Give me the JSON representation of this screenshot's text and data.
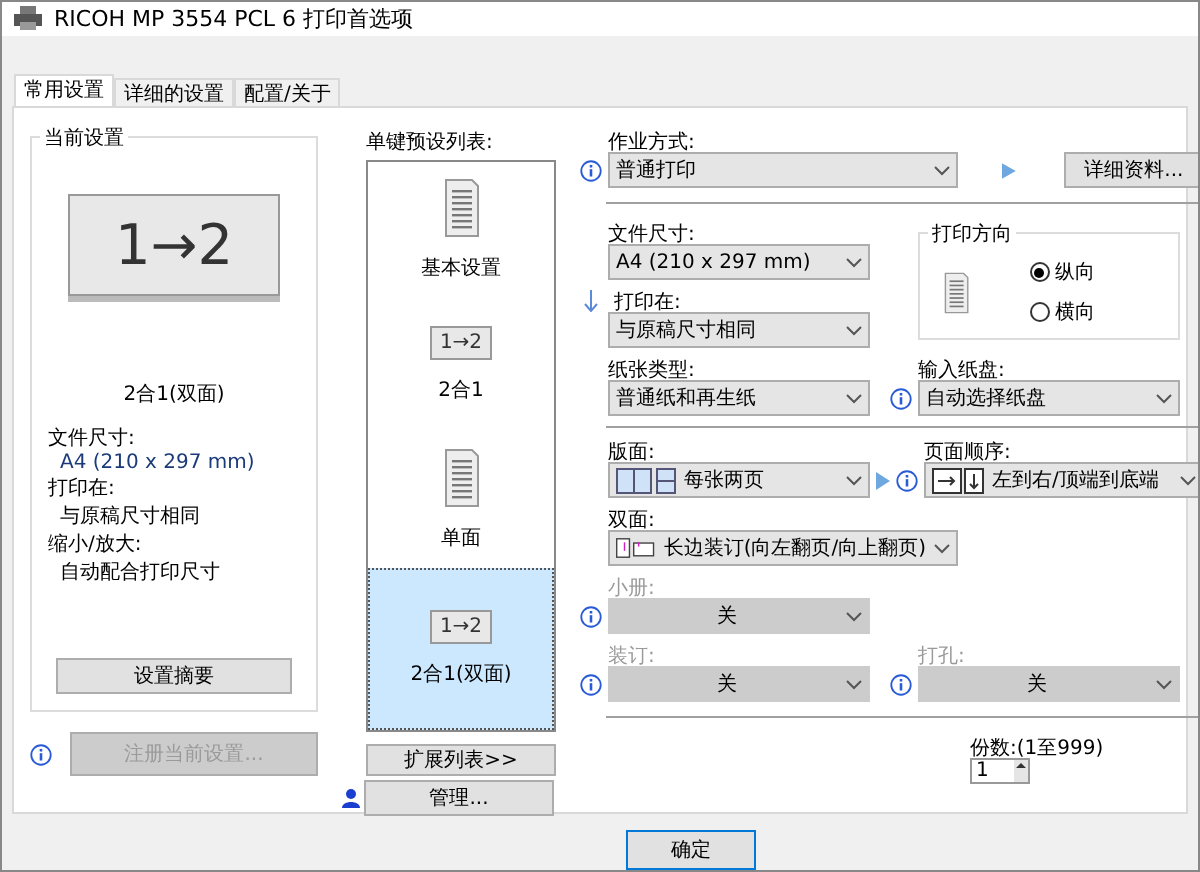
{
  "window": {
    "title": "RICOH MP 3554 PCL 6 打印首选项"
  },
  "tabs": [
    {
      "label": "常用设置",
      "selected": true
    },
    {
      "label": "详细的设置",
      "selected": false
    },
    {
      "label": "配置/关于",
      "selected": false
    }
  ],
  "current_settings": {
    "title": "当前设置",
    "preview": "1→2",
    "caption": "2合1(双面)",
    "details": [
      {
        "label": "文件尺寸:",
        "value": "A4 (210 x 297 mm)"
      },
      {
        "label": "打印在:",
        "value": "与原稿尺寸相同"
      },
      {
        "label": "缩小/放大:",
        "value": "自动配合打印尺寸"
      }
    ],
    "summary_button": "设置摘要"
  },
  "register_button": {
    "label": "注册当前设置...",
    "disabled": true
  },
  "presets": {
    "title": "单键预设列表:",
    "items": [
      {
        "label": "基本设置",
        "kind": "document",
        "selected": false
      },
      {
        "label": "2合1",
        "kind": "combine",
        "glyph": "1→2",
        "selected": false
      },
      {
        "label": "单面",
        "kind": "document",
        "selected": false
      },
      {
        "label": "2合1(双面)",
        "kind": "combine",
        "glyph": "1→2",
        "selected": true
      }
    ]
  },
  "expand_button": "扩展列表>>",
  "manage_button": "管理...",
  "job": {
    "label": "作业方式:",
    "value": "普通打印",
    "info": true
  },
  "details_button": "详细资料...",
  "paper_size": {
    "label": "文件尺寸:",
    "value": "A4 (210 x 297 mm)"
  },
  "print_on": {
    "label": "打印在:",
    "value": "与原稿尺寸相同"
  },
  "orientation": {
    "title": "打印方向",
    "options": [
      {
        "label": "纵向",
        "selected": true
      },
      {
        "label": "横向",
        "selected": false
      }
    ]
  },
  "paper_type": {
    "label": "纸张类型:",
    "value": "普通纸和再生纸"
  },
  "input_tray": {
    "label": "输入纸盘:",
    "value": "自动选择纸盘",
    "info": true
  },
  "layout": {
    "label": "版面:",
    "value": "每张两页"
  },
  "page_order": {
    "label": "页面顺序:",
    "value": "左到右/顶端到底端",
    "info": true
  },
  "duplex": {
    "label": "双面:",
    "value": "长边装订(向左翻页/向上翻页)"
  },
  "booklet": {
    "label": "小册:",
    "value": "关",
    "disabled": true,
    "info": true
  },
  "binding": {
    "label": "装订:",
    "value": "关",
    "disabled": true,
    "info": true
  },
  "punch": {
    "label": "打孔:",
    "value": "关",
    "disabled": true,
    "info": true
  },
  "copies": {
    "label": "份数:(1至999)",
    "value": "1"
  },
  "footer_buttons": [
    {
      "label": "确定",
      "default": true
    }
  ]
}
